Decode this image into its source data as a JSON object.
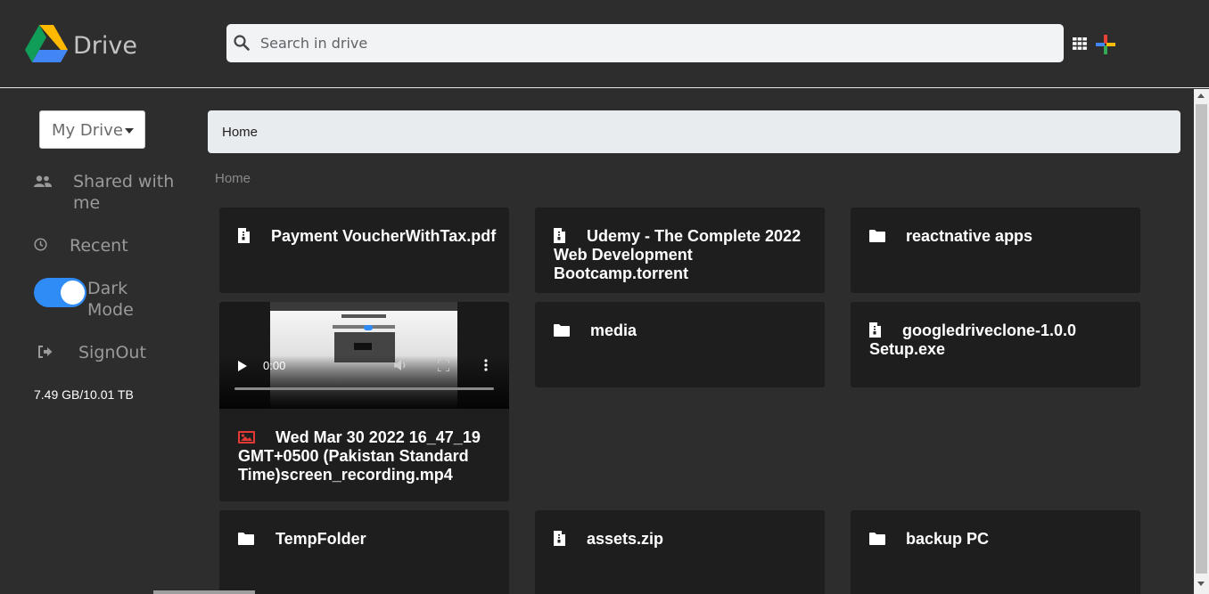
{
  "app": {
    "name": "Drive",
    "search_placeholder": "Search in drive"
  },
  "sidebar": {
    "dropdown_label": "My Drive",
    "items": [
      {
        "label": "Shared with me",
        "icon": "people-icon"
      },
      {
        "label": "Recent",
        "icon": "clock-icon"
      },
      {
        "label": "Dark Mode",
        "icon": "toggle-icon",
        "toggle_on": true
      },
      {
        "label": "SignOut",
        "icon": "sign-out-icon"
      }
    ],
    "storage": "7.49 GB/10.01 TB"
  },
  "main": {
    "breadcrumb_bar": "Home",
    "breadcrumb": "Home",
    "files": [
      {
        "name": "Payment VoucherWithTax.pdf",
        "icon": "file-icon",
        "type": "file"
      },
      {
        "name": "Udemy - The Complete 2022 Web Development Bootcamp.torrent",
        "icon": "file-icon",
        "type": "file"
      },
      {
        "name": "reactnative apps",
        "icon": "folder-icon",
        "type": "folder"
      },
      {
        "name": "Wed Mar 30 2022 16_47_19 GMT+0500 (Pakistan Standard Time)screen_recording.mp4",
        "icon": "image-icon",
        "type": "video",
        "video_time": "0:00"
      },
      {
        "name": "media",
        "icon": "folder-icon",
        "type": "folder"
      },
      {
        "name": "googledriveclone-1.0.0 Setup.exe",
        "icon": "file-icon",
        "type": "file"
      },
      {
        "name": "TempFolder",
        "icon": "folder-icon",
        "type": "folder"
      },
      {
        "name": "assets.zip",
        "icon": "file-icon",
        "type": "file"
      },
      {
        "name": "backup PC",
        "icon": "folder-icon",
        "type": "folder"
      }
    ]
  },
  "colors": {
    "background": "#2d2d2d",
    "card": "#1e1e1e",
    "toggle_accent": "#2f8bf5",
    "image_icon": "#e53935"
  }
}
